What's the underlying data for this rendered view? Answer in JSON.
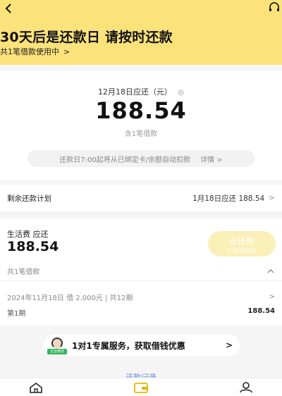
{
  "header": {
    "back_icon": "chevron-left-icon",
    "service_icon": "headset-icon",
    "title": "30天后是还款日 请按时还款",
    "subtitle": "共1笔借款使用中",
    "subtitle_arrow": ">"
  },
  "summary": {
    "due_label": "12月18日应还（元）",
    "amount": "188.54",
    "loan_count": "含1笔借款",
    "auto_notice": "还款日7:00起将从已绑定卡/余额自动扣款",
    "details_link": "详情 >"
  },
  "plan": {
    "label": "剩余还款计划",
    "value": "1月18日应还 188.54",
    "arrow": ">"
  },
  "living_fee": {
    "title": "生活费 应还",
    "amount": "188.54",
    "repay_button": "去还款",
    "repay_hint": "27天后可还",
    "loans_label": "共1笔借款",
    "collapse_arrow": "^",
    "loan_info": "2024年11月18日  借 2,000元  | 共12期",
    "loan_arrow": ">",
    "period_label": "第1期",
    "period_amount": "188.54"
  },
  "promo": {
    "badge": "企业微信",
    "text": "1对1专属服务，获取借钱优惠",
    "arrow": ">"
  },
  "records_link": "还款记录",
  "tabbar": {
    "tabs": [
      {
        "icon": "home-icon",
        "active": false
      },
      {
        "icon": "wallet-icon",
        "active": true
      },
      {
        "icon": "user-icon",
        "active": false
      }
    ]
  },
  "colors": {
    "hero_bg": "#fbe27a",
    "repay_button_bg": "#fbefb8",
    "link": "#6a8ad6",
    "active_tab": "#e6b800"
  }
}
